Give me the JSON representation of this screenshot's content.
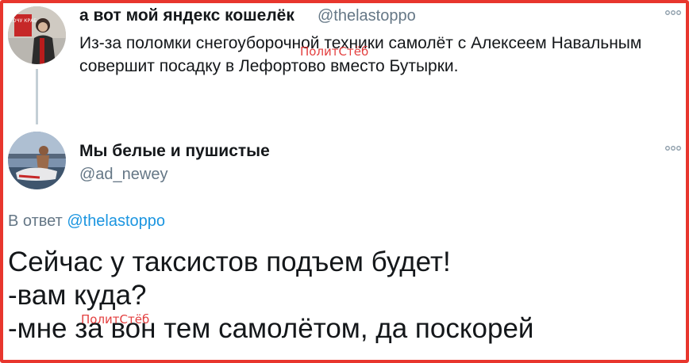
{
  "tweet1": {
    "author_name": "а вот мой яндекс кошелёк",
    "handle": "@thelastoppo",
    "text_line1": "Из-за поломки снегоуборочной техники самолёт с Алексеем Навальным",
    "text_line2": "совершит посадку в Лефортово вместо Бутырки.",
    "avatar_sign_text": "ХОЧУ КРАБ",
    "more_icon": "more-options-icon"
  },
  "tweet2": {
    "author_name": "Мы белые и пушистые",
    "handle": "@ad_newey",
    "reply_prefix": "В ответ ",
    "reply_to": "@thelastoppo",
    "text_lines": [
      "Сейчас у таксистов подъем будет!",
      "-вам куда?",
      "-мне за вон тем самолётом, да поскорей"
    ],
    "more_icon": "more-options-icon"
  },
  "watermark": "ПолитСтёб",
  "colors": {
    "frame_border": "#e8362d",
    "link": "#1b95e0",
    "secondary_text": "#657786",
    "thread_line": "#c4cfd6",
    "watermark": "#e02b2b"
  }
}
